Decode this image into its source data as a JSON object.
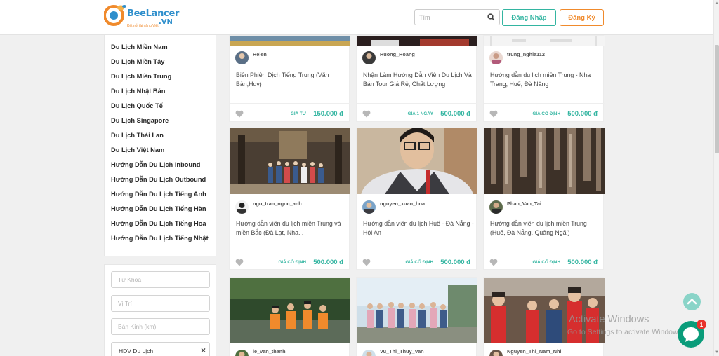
{
  "header": {
    "logo_text": "BeeLancer",
    "logo_domain": ".VN",
    "logo_tagline": "Kết nối tài năng Việt",
    "search_placeholder": "Tìm",
    "login_label": "Đăng Nhập",
    "signup_label": "Đăng Ký"
  },
  "sidebar": {
    "items": [
      "Du Lịch Miền Nam",
      "Du Lịch Miền Tây",
      "Du Lịch Miền Trung",
      "Du Lịch Nhật Bản",
      "Du Lịch Quốc Tế",
      "Du Lịch Singapore",
      "Du Lịch Thái Lan",
      "Du Lịch Việt Nam",
      "Hướng Dẫn Du Lịch Inbound",
      "Hướng Dẫn Du Lịch Outbound",
      "Hướng Dẫn Du Lịch Tiếng Anh",
      "Hướng Dẫn Du Lịch Tiếng Hàn",
      "Hướng Dẫn Du Lịch Tiếng Hoa",
      "Hướng Dẫn Du Lịch Tiếng Nhật"
    ]
  },
  "filters": {
    "keyword_placeholder": "Từ Khoá",
    "location_placeholder": "Vị Trí",
    "radius_placeholder": "Bán Kính (km)",
    "selected_tag": "HDV Du Lịch",
    "remove_symbol": "×"
  },
  "cards": [
    {
      "user": "Helen",
      "title": "Biên Phiên Dịch Tiếng Trung (Văn Bản,Hdv)",
      "price_label": "Giá từ",
      "price": "150.000 đ"
    },
    {
      "user": "Huong_Hoang",
      "title": "Nhận Làm Hướng Dẫn Viên Du Lịch Và Bán Tour Giá Rẻ, Chất Lượng",
      "price_label": "Giá 1 ngày",
      "price": "500.000 đ"
    },
    {
      "user": "trung_nghia112",
      "title": "Hướng dẫn du lịch miền Trung - Nha Trang, Huế, Đà Nẵng",
      "price_label": "Giá cố định",
      "price": "500.000 đ"
    },
    {
      "user": "ngo_tran_ngoc_anh",
      "title": "Hướng dẫn viên du lịch miền Trung và miền Bắc (Đà Lạt, Nha...",
      "price_label": "Giá cố định",
      "price": "500.000 đ"
    },
    {
      "user": "nguyen_xuan_hoa",
      "title": "Hướng dẫn viên du lịch Huế - Đà Nẵng - Hội An",
      "price_label": "Giá cố định",
      "price": "500.000 đ"
    },
    {
      "user": "Phan_Van_Tai",
      "title": "Hướng dẫn viên du lịch miền Trung (Huế, Đà Nẵng, Quảng Ngãi)",
      "price_label": "Giá cố định",
      "price": "500.000 đ"
    },
    {
      "user": "le_van_thanh",
      "title": "",
      "price_label": "",
      "price": ""
    },
    {
      "user": "Vu_Thi_Thuy_Van",
      "title": "",
      "price_label": "",
      "price": ""
    },
    {
      "user": "Nguyen_Thi_Nam_Nhi",
      "title": "",
      "price_label": "",
      "price": ""
    }
  ],
  "overlay": {
    "watermark_title": "Activate Windows",
    "watermark_sub": "Go to Settings to activate Windows.",
    "chat_badge": "1"
  },
  "colors": {
    "accent": "#33b5a1",
    "signup": "#f08a2c",
    "brand": "#2f8fcc",
    "chat": "#0a9c7a",
    "badge": "#e8332c"
  }
}
